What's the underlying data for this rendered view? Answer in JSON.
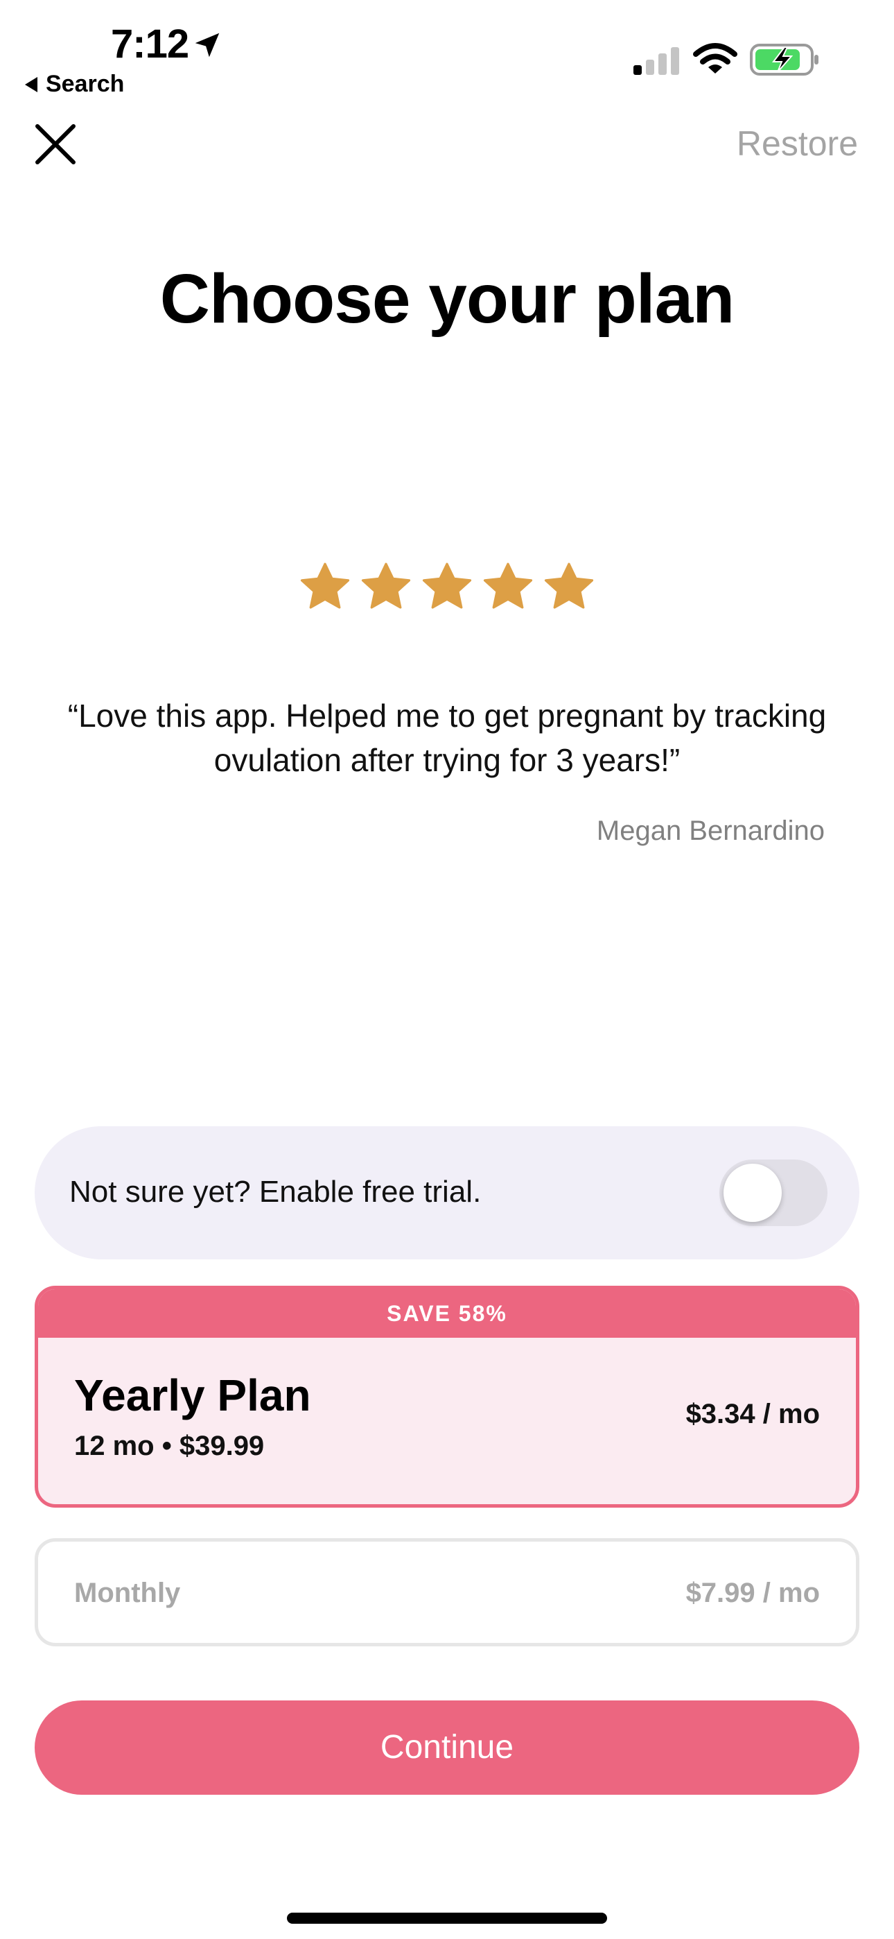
{
  "status_bar": {
    "time": "7:12",
    "back_label": "Search",
    "icons": [
      "location-arrow-icon",
      "signal-icon",
      "wifi-icon",
      "battery-charging-icon"
    ]
  },
  "nav": {
    "close_icon": "close-icon",
    "restore_label": "Restore"
  },
  "title": "Choose your plan",
  "rating": {
    "stars": 5,
    "star_color": "#dd9f45"
  },
  "review": {
    "quote": "“Love this app. Helped me to get pregnant by tracking ovulation after trying for 3 years!”",
    "author": "Megan Bernardino"
  },
  "free_trial": {
    "label": "Not sure yet? Enable free trial.",
    "enabled": false
  },
  "plans": [
    {
      "badge": "SAVE 58%",
      "name": "Yearly Plan",
      "detail": "12 mo • $39.99",
      "price": "$3.34 / mo",
      "selected": true
    },
    {
      "name": "Monthly",
      "price": "$7.99 / mo",
      "selected": false
    }
  ],
  "cta": {
    "label": "Continue"
  },
  "colors": {
    "accent": "#ec6680",
    "selected_card_bg": "#fbebf1",
    "trial_row_bg": "#f1eff8",
    "muted_text": "#a8a8a8"
  }
}
